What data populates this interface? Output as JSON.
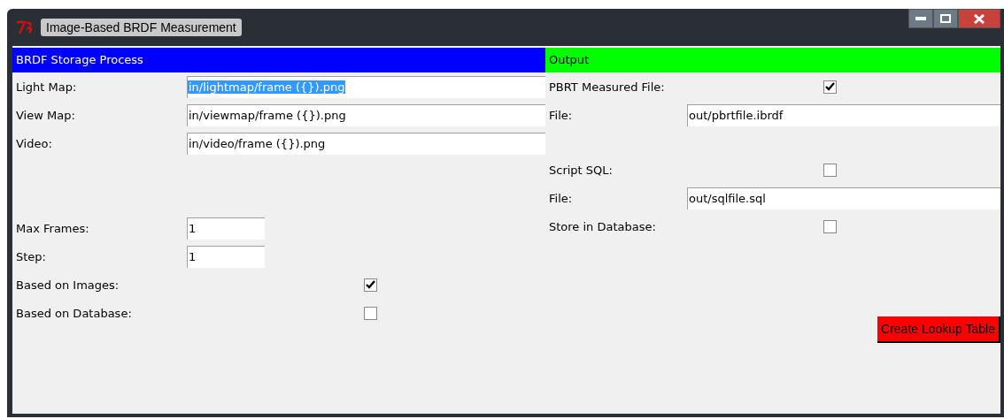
{
  "window": {
    "title": "Image-Based BRDF Measurement"
  },
  "left": {
    "header": "BRDF Storage Process",
    "paths": [
      {
        "label": "Light Map:",
        "value": "in/lightmap/frame ({}).png",
        "text_selected": true
      },
      {
        "label": "View Map:",
        "value": "in/viewmap/frame ({}).png",
        "text_selected": false
      },
      {
        "label": "Video:",
        "value": "in/video/frame ({}).png",
        "text_selected": false
      }
    ],
    "settings": [
      {
        "label": "Max Frames:",
        "value": "1"
      },
      {
        "label": "Step:",
        "value": "1"
      }
    ],
    "options": [
      {
        "label": "Based on Images:",
        "checked": true
      },
      {
        "label": "Based on Database:",
        "checked": false
      }
    ]
  },
  "right": {
    "header": "Output",
    "outputs": [
      {
        "label": "PBRT Measured File:",
        "checked": true,
        "file_label": "File:",
        "file": "out/pbrtfile.ibrdf"
      },
      {
        "label": "Script SQL:",
        "checked": false,
        "file_label": "File:",
        "file": "out/sqlfile.sql"
      }
    ],
    "store": {
      "label": "Store in Database:",
      "checked": false
    },
    "button": "Create Lookup Table"
  }
}
